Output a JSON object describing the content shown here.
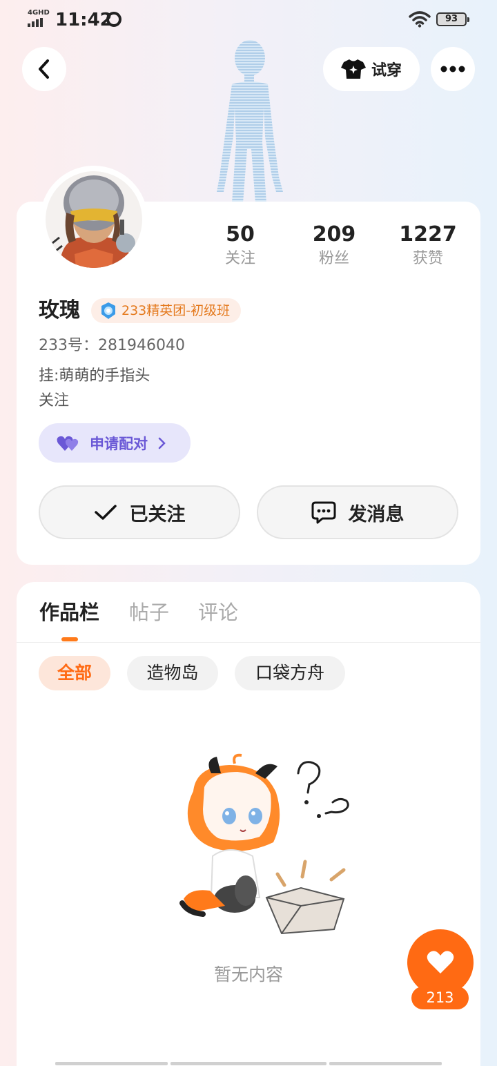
{
  "status_bar": {
    "network": "4GHD",
    "time": "11:42",
    "battery": "93"
  },
  "header": {
    "try_on_label": "试穿"
  },
  "profile": {
    "stats": [
      {
        "value": "50",
        "label": "关注"
      },
      {
        "value": "209",
        "label": "粉丝"
      },
      {
        "value": "1227",
        "label": "获赞"
      }
    ],
    "name": "玫瑰",
    "badge": "233精英团-初级班",
    "uid": "233号：281946040",
    "bio_line1": "挂:萌萌的手指头",
    "bio_line2": "关注",
    "pair_button": "申请配对",
    "follow_button": "已关注",
    "message_button": "发消息"
  },
  "content": {
    "tabs": [
      {
        "label": "作品栏",
        "active": true
      },
      {
        "label": "帖子",
        "active": false
      },
      {
        "label": "评论",
        "active": false
      }
    ],
    "filters": [
      {
        "label": "全部",
        "active": true
      },
      {
        "label": "造物岛",
        "active": false
      },
      {
        "label": "口袋方舟",
        "active": false
      }
    ],
    "empty_text": "暂无内容"
  },
  "like": {
    "count": "213"
  },
  "colors": {
    "accent": "#ff6a13",
    "pair": "#6a58d6",
    "badge_text": "#e47a1e"
  }
}
